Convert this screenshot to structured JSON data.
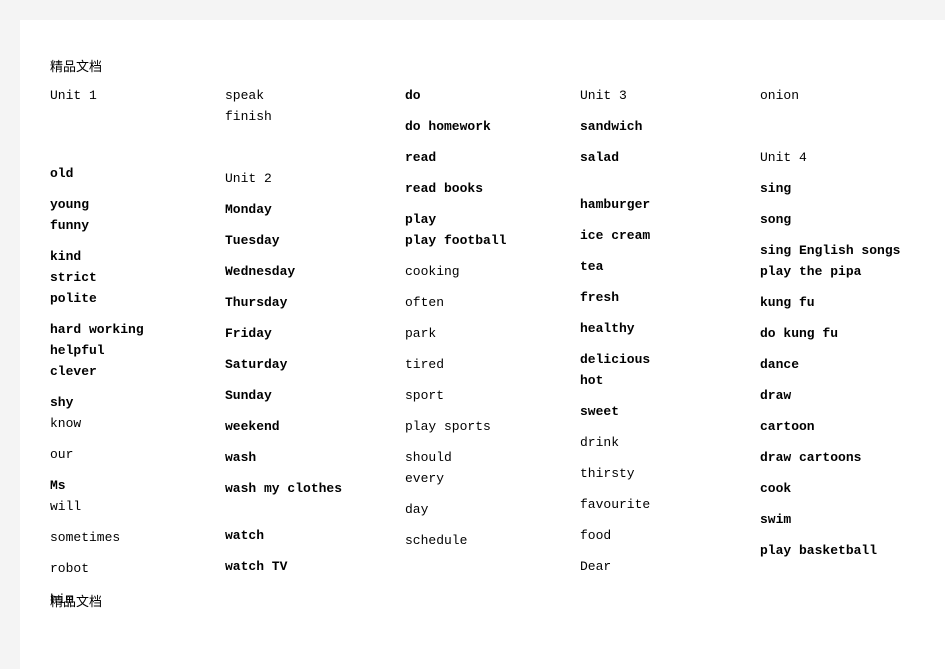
{
  "document": {
    "header_watermark": "精品文档",
    "footer_watermark": "精品文档",
    "page_background": "#ffffff",
    "canvas_background": "#f4f4f4",
    "text_color": "#000000"
  },
  "columns": [
    {
      "id": "column-1",
      "items": [
        {
          "text": "Unit 1",
          "bold": false,
          "gap": 0
        },
        {
          "text": "old",
          "bold": true,
          "gap": 5
        },
        {
          "text": "young",
          "bold": true,
          "gap": 2
        },
        {
          "text": "funny",
          "bold": true,
          "gap": 1
        },
        {
          "text": "kind",
          "bold": true,
          "gap": 2
        },
        {
          "text": "strict",
          "bold": true,
          "gap": 1
        },
        {
          "text": "polite",
          "bold": true,
          "gap": 1
        },
        {
          "text": "hard working",
          "bold": true,
          "gap": 2
        },
        {
          "text": "helpful",
          "bold": true,
          "gap": 1
        },
        {
          "text": "clever",
          "bold": true,
          "gap": 1
        },
        {
          "text": "shy",
          "bold": true,
          "gap": 2
        },
        {
          "text": "know",
          "bold": false,
          "gap": 1
        },
        {
          "text": "our",
          "bold": false,
          "gap": 2
        },
        {
          "text": "Ms",
          "bold": true,
          "gap": 2
        },
        {
          "text": "will",
          "bold": false,
          "gap": 1
        },
        {
          "text": "sometimes",
          "bold": false,
          "gap": 2
        },
        {
          "text": "robot",
          "bold": false,
          "gap": 2
        },
        {
          "text": "him",
          "bold": false,
          "gap": 2
        }
      ]
    },
    {
      "id": "column-2",
      "items": [
        {
          "text": "speak",
          "bold": false,
          "gap": 0
        },
        {
          "text": "finish",
          "bold": false,
          "gap": 1
        },
        {
          "text": "Unit 2",
          "bold": false,
          "gap": 4
        },
        {
          "text": "Monday",
          "bold": true,
          "gap": 2
        },
        {
          "text": "Tuesday",
          "bold": true,
          "gap": 2
        },
        {
          "text": "Wednesday",
          "bold": true,
          "gap": 2
        },
        {
          "text": "Thursday",
          "bold": true,
          "gap": 2
        },
        {
          "text": "Friday",
          "bold": true,
          "gap": 2
        },
        {
          "text": "Saturday",
          "bold": true,
          "gap": 2
        },
        {
          "text": "Sunday",
          "bold": true,
          "gap": 2
        },
        {
          "text": "weekend",
          "bold": true,
          "gap": 2
        },
        {
          "text": "wash",
          "bold": true,
          "gap": 2
        },
        {
          "text": "wash my clothes",
          "bold": true,
          "gap": 2
        },
        {
          "text": "watch",
          "bold": true,
          "gap": 3
        },
        {
          "text": "watch TV",
          "bold": true,
          "gap": 2
        }
      ]
    },
    {
      "id": "column-3",
      "items": [
        {
          "text": "do",
          "bold": true,
          "gap": 0
        },
        {
          "text": "do homework",
          "bold": true,
          "gap": 2
        },
        {
          "text": "read",
          "bold": true,
          "gap": 2
        },
        {
          "text": "read books",
          "bold": true,
          "gap": 2
        },
        {
          "text": "play",
          "bold": true,
          "gap": 2
        },
        {
          "text": "play football",
          "bold": true,
          "gap": 1
        },
        {
          "text": "cooking",
          "bold": false,
          "gap": 2
        },
        {
          "text": "often",
          "bold": false,
          "gap": 2
        },
        {
          "text": "park",
          "bold": false,
          "gap": 2
        },
        {
          "text": "tired",
          "bold": false,
          "gap": 2
        },
        {
          "text": "sport",
          "bold": false,
          "gap": 2
        },
        {
          "text": "play sports",
          "bold": false,
          "gap": 2
        },
        {
          "text": "should",
          "bold": false,
          "gap": 2
        },
        {
          "text": "every",
          "bold": false,
          "gap": 1
        },
        {
          "text": "day",
          "bold": false,
          "gap": 2
        },
        {
          "text": "schedule",
          "bold": false,
          "gap": 2
        }
      ]
    },
    {
      "id": "column-4",
      "items": [
        {
          "text": "Unit 3",
          "bold": false,
          "gap": 0
        },
        {
          "text": "sandwich",
          "bold": true,
          "gap": 2
        },
        {
          "text": "salad",
          "bold": true,
          "gap": 2
        },
        {
          "text": "hamburger",
          "bold": true,
          "gap": 3
        },
        {
          "text": "ice cream",
          "bold": true,
          "gap": 2
        },
        {
          "text": "tea",
          "bold": true,
          "gap": 2
        },
        {
          "text": "fresh",
          "bold": true,
          "gap": 2
        },
        {
          "text": "healthy",
          "bold": true,
          "gap": 2
        },
        {
          "text": "delicious",
          "bold": true,
          "gap": 2
        },
        {
          "text": "hot",
          "bold": true,
          "gap": 1
        },
        {
          "text": "sweet",
          "bold": true,
          "gap": 2
        },
        {
          "text": "drink",
          "bold": false,
          "gap": 2
        },
        {
          "text": "thirsty",
          "bold": false,
          "gap": 2
        },
        {
          "text": "favourite",
          "bold": false,
          "gap": 2
        },
        {
          "text": "food",
          "bold": false,
          "gap": 2
        },
        {
          "text": "Dear",
          "bold": false,
          "gap": 2
        }
      ]
    },
    {
      "id": "column-5",
      "items": [
        {
          "text": "onion",
          "bold": false,
          "gap": 0
        },
        {
          "text": "Unit 4",
          "bold": false,
          "gap": 4
        },
        {
          "text": "sing",
          "bold": true,
          "gap": 2
        },
        {
          "text": "song",
          "bold": true,
          "gap": 2
        },
        {
          "text": "sing English songs",
          "bold": true,
          "gap": 2
        },
        {
          "text": "play the pipa",
          "bold": true,
          "gap": 1
        },
        {
          "text": "kung fu",
          "bold": true,
          "gap": 2
        },
        {
          "text": "do kung fu",
          "bold": true,
          "gap": 2
        },
        {
          "text": "dance",
          "bold": true,
          "gap": 2
        },
        {
          "text": "draw",
          "bold": true,
          "gap": 2
        },
        {
          "text": "cartoon",
          "bold": true,
          "gap": 2
        },
        {
          "text": "draw cartoons",
          "bold": true,
          "gap": 2
        },
        {
          "text": "cook",
          "bold": true,
          "gap": 2
        },
        {
          "text": "swim",
          "bold": true,
          "gap": 2
        },
        {
          "text": "play basketball",
          "bold": true,
          "gap": 2
        }
      ]
    }
  ]
}
